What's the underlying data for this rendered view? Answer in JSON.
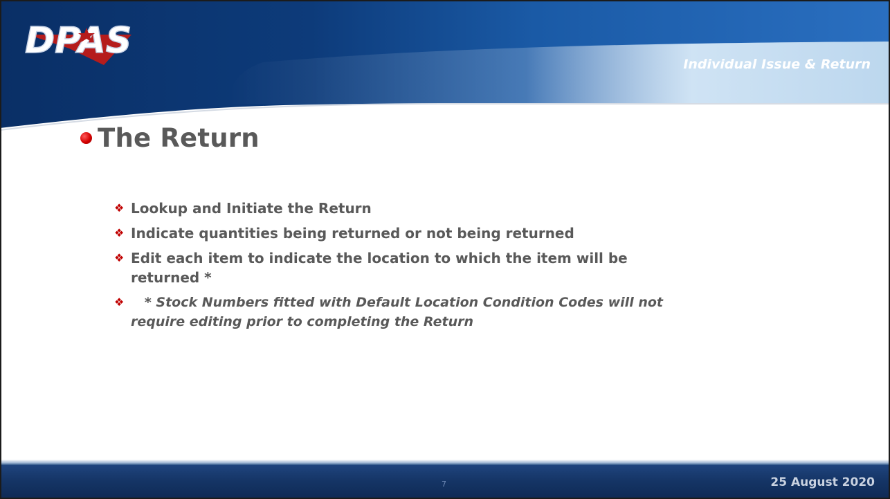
{
  "header": {
    "logo_text": "DPAS",
    "subtitle": "Individual Issue & Return"
  },
  "slide": {
    "title": "The Return",
    "bullets": [
      "Lookup and Initiate the Return",
      "Indicate quantities being returned or not being returned",
      "Edit each item to indicate the location to which the item will be returned *"
    ],
    "note": "   * Stock Numbers fitted with Default Location Condition Codes will not require editing prior to completing the Return"
  },
  "footer": {
    "page_number": "7",
    "date": "25 August 2020"
  },
  "colors": {
    "header_dark_blue": "#0d3b7a",
    "accent_red": "#c00000",
    "text_gray": "#595959",
    "footer_blue": "#153566"
  },
  "icons": {
    "bullet_marker": "diamond-bullet-icon",
    "title_marker": "red-dot-icon"
  }
}
